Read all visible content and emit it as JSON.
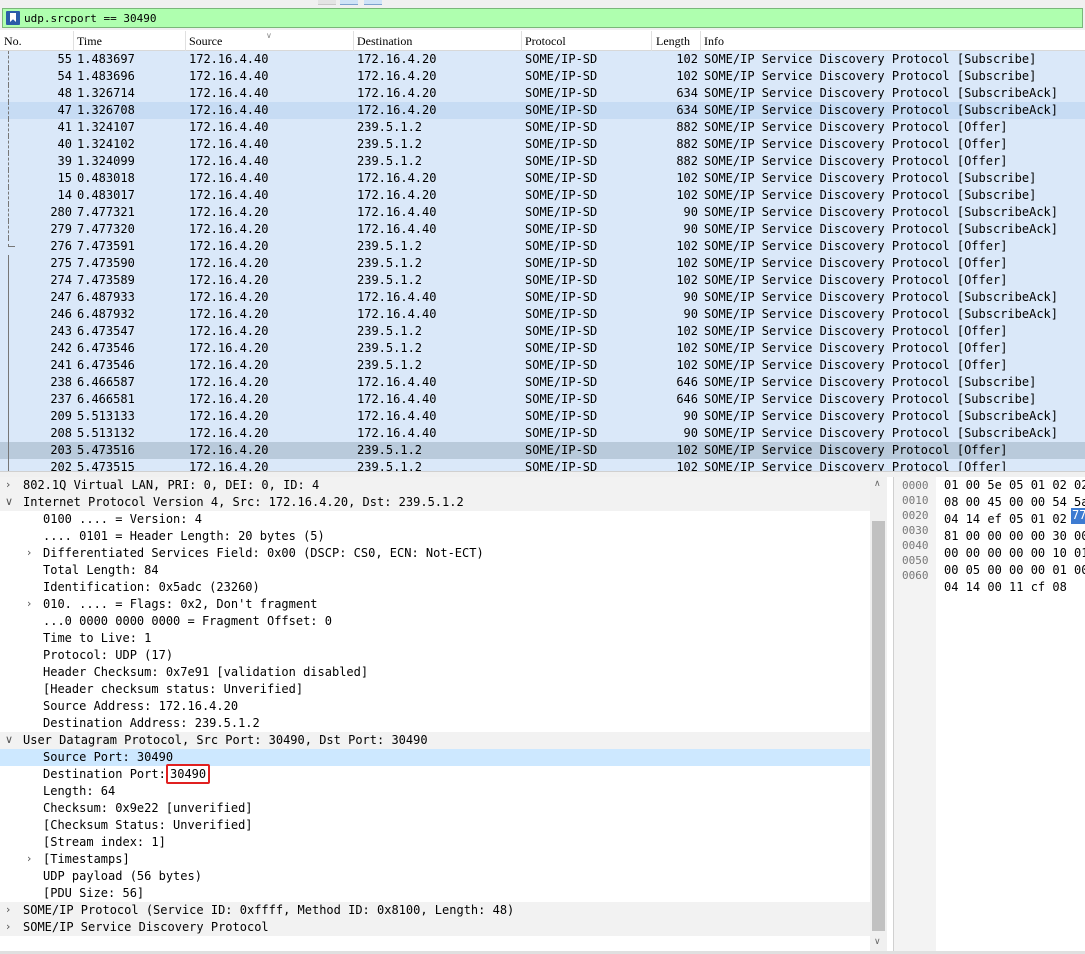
{
  "filter": {
    "expression": "udp.srcport == 30490"
  },
  "columns": [
    "No.",
    "Time",
    "Source",
    "Destination",
    "Protocol",
    "Length",
    "Info"
  ],
  "packets": [
    {
      "no": "55",
      "time": "1.483697",
      "src": "172.16.4.40",
      "dst": "172.16.4.20",
      "proto": "SOME/IP-SD",
      "len": "102",
      "info": "SOME/IP Service Discovery Protocol [Subscribe]"
    },
    {
      "no": "54",
      "time": "1.483696",
      "src": "172.16.4.40",
      "dst": "172.16.4.20",
      "proto": "SOME/IP-SD",
      "len": "102",
      "info": "SOME/IP Service Discovery Protocol [Subscribe]"
    },
    {
      "no": "48",
      "time": "1.326714",
      "src": "172.16.4.40",
      "dst": "172.16.4.20",
      "proto": "SOME/IP-SD",
      "len": "634",
      "info": "SOME/IP Service Discovery Protocol [SubscribeAck]"
    },
    {
      "no": "47",
      "time": "1.326708",
      "src": "172.16.4.40",
      "dst": "172.16.4.20",
      "proto": "SOME/IP-SD",
      "len": "634",
      "info": "SOME/IP Service Discovery Protocol [SubscribeAck]"
    },
    {
      "no": "41",
      "time": "1.324107",
      "src": "172.16.4.40",
      "dst": "239.5.1.2",
      "proto": "SOME/IP-SD",
      "len": "882",
      "info": "SOME/IP Service Discovery Protocol [Offer]"
    },
    {
      "no": "40",
      "time": "1.324102",
      "src": "172.16.4.40",
      "dst": "239.5.1.2",
      "proto": "SOME/IP-SD",
      "len": "882",
      "info": "SOME/IP Service Discovery Protocol [Offer]"
    },
    {
      "no": "39",
      "time": "1.324099",
      "src": "172.16.4.40",
      "dst": "239.5.1.2",
      "proto": "SOME/IP-SD",
      "len": "882",
      "info": "SOME/IP Service Discovery Protocol [Offer]"
    },
    {
      "no": "15",
      "time": "0.483018",
      "src": "172.16.4.40",
      "dst": "172.16.4.20",
      "proto": "SOME/IP-SD",
      "len": "102",
      "info": "SOME/IP Service Discovery Protocol [Subscribe]"
    },
    {
      "no": "14",
      "time": "0.483017",
      "src": "172.16.4.40",
      "dst": "172.16.4.20",
      "proto": "SOME/IP-SD",
      "len": "102",
      "info": "SOME/IP Service Discovery Protocol [Subscribe]"
    },
    {
      "no": "280",
      "time": "7.477321",
      "src": "172.16.4.20",
      "dst": "172.16.4.40",
      "proto": "SOME/IP-SD",
      "len": "90",
      "info": "SOME/IP Service Discovery Protocol [SubscribeAck]"
    },
    {
      "no": "279",
      "time": "7.477320",
      "src": "172.16.4.20",
      "dst": "172.16.4.40",
      "proto": "SOME/IP-SD",
      "len": "90",
      "info": "SOME/IP Service Discovery Protocol [SubscribeAck]"
    },
    {
      "no": "276",
      "time": "7.473591",
      "src": "172.16.4.20",
      "dst": "239.5.1.2",
      "proto": "SOME/IP-SD",
      "len": "102",
      "info": "SOME/IP Service Discovery Protocol [Offer]"
    },
    {
      "no": "275",
      "time": "7.473590",
      "src": "172.16.4.20",
      "dst": "239.5.1.2",
      "proto": "SOME/IP-SD",
      "len": "102",
      "info": "SOME/IP Service Discovery Protocol [Offer]"
    },
    {
      "no": "274",
      "time": "7.473589",
      "src": "172.16.4.20",
      "dst": "239.5.1.2",
      "proto": "SOME/IP-SD",
      "len": "102",
      "info": "SOME/IP Service Discovery Protocol [Offer]"
    },
    {
      "no": "247",
      "time": "6.487933",
      "src": "172.16.4.20",
      "dst": "172.16.4.40",
      "proto": "SOME/IP-SD",
      "len": "90",
      "info": "SOME/IP Service Discovery Protocol [SubscribeAck]"
    },
    {
      "no": "246",
      "time": "6.487932",
      "src": "172.16.4.20",
      "dst": "172.16.4.40",
      "proto": "SOME/IP-SD",
      "len": "90",
      "info": "SOME/IP Service Discovery Protocol [SubscribeAck]"
    },
    {
      "no": "243",
      "time": "6.473547",
      "src": "172.16.4.20",
      "dst": "239.5.1.2",
      "proto": "SOME/IP-SD",
      "len": "102",
      "info": "SOME/IP Service Discovery Protocol [Offer]"
    },
    {
      "no": "242",
      "time": "6.473546",
      "src": "172.16.4.20",
      "dst": "239.5.1.2",
      "proto": "SOME/IP-SD",
      "len": "102",
      "info": "SOME/IP Service Discovery Protocol [Offer]"
    },
    {
      "no": "241",
      "time": "6.473546",
      "src": "172.16.4.20",
      "dst": "239.5.1.2",
      "proto": "SOME/IP-SD",
      "len": "102",
      "info": "SOME/IP Service Discovery Protocol [Offer]"
    },
    {
      "no": "238",
      "time": "6.466587",
      "src": "172.16.4.20",
      "dst": "172.16.4.40",
      "proto": "SOME/IP-SD",
      "len": "646",
      "info": "SOME/IP Service Discovery Protocol [Subscribe]"
    },
    {
      "no": "237",
      "time": "6.466581",
      "src": "172.16.4.20",
      "dst": "172.16.4.40",
      "proto": "SOME/IP-SD",
      "len": "646",
      "info": "SOME/IP Service Discovery Protocol [Subscribe]"
    },
    {
      "no": "209",
      "time": "5.513133",
      "src": "172.16.4.20",
      "dst": "172.16.4.40",
      "proto": "SOME/IP-SD",
      "len": "90",
      "info": "SOME/IP Service Discovery Protocol [SubscribeAck]"
    },
    {
      "no": "208",
      "time": "5.513132",
      "src": "172.16.4.20",
      "dst": "172.16.4.40",
      "proto": "SOME/IP-SD",
      "len": "90",
      "info": "SOME/IP Service Discovery Protocol [SubscribeAck]"
    },
    {
      "no": "203",
      "time": "5.473516",
      "src": "172.16.4.20",
      "dst": "239.5.1.2",
      "proto": "SOME/IP-SD",
      "len": "102",
      "info": "SOME/IP Service Discovery Protocol [Offer]"
    },
    {
      "no": "202",
      "time": "5.473515",
      "src": "172.16.4.20",
      "dst": "239.5.1.2",
      "proto": "SOME/IP-SD",
      "len": "102",
      "info": "SOME/IP Service Discovery Protocol [Offer]"
    }
  ],
  "detail": {
    "vlan": "802.1Q Virtual LAN, PRI: 0, DEI: 0, ID: 4",
    "ipv4": "Internet Protocol Version 4, Src: 172.16.4.20, Dst: 239.5.1.2",
    "ip_fields": {
      "version": "0100 .... = Version: 4",
      "header_length": ".... 0101 = Header Length: 20 bytes (5)",
      "dsfield": "Differentiated Services Field: 0x00 (DSCP: CS0, ECN: Not-ECT)",
      "total_length": "Total Length: 84",
      "identification": "Identification: 0x5adc (23260)",
      "flags": "010. .... = Flags: 0x2, Don't fragment",
      "frag_offset": "...0 0000 0000 0000 = Fragment Offset: 0",
      "ttl": "Time to Live: 1",
      "protocol": "Protocol: UDP (17)",
      "checksum": "Header Checksum: 0x7e91 [validation disabled]",
      "checksum_status": "[Header checksum status: Unverified]",
      "src_addr": "Source Address: 172.16.4.20",
      "dst_addr": "Destination Address: 239.5.1.2"
    },
    "udp": "User Datagram Protocol, Src Port: 30490, Dst Port: 30490",
    "udp_fields": {
      "src_port": "Source Port: 30490",
      "dst_port_label": "Destination Port: ",
      "dst_port_value": "30490",
      "length": "Length: 64",
      "checksum": "Checksum: 0x9e22 [unverified]",
      "checksum_status": "[Checksum Status: Unverified]",
      "stream_index": "[Stream index: 1]",
      "timestamps": "[Timestamps]",
      "payload": "UDP payload (56 bytes)",
      "pdu_size": "[PDU Size: 56]"
    },
    "someip": "SOME/IP Protocol (Service ID: 0xffff, Method ID: 0x8100, Length: 48)",
    "someip_sd": "SOME/IP Service Discovery Protocol"
  },
  "hex": {
    "offsets": [
      "0000",
      "0010",
      "0020",
      "0030",
      "0040",
      "0050",
      "0060"
    ],
    "lines": [
      "01 00 5e 05 01 02 02",
      "08 00 45 00 00 54 5a",
      "04 14 ef 05 01 02",
      "81 00 00 00 00 30 00",
      "00 00 00 00 00 10 01",
      "00 05 00 00 00 01 00",
      "04 14 00 11 cf 08"
    ],
    "selected_byte": "77"
  },
  "colors": {
    "row_bg": "#dae8f9",
    "row_selected": "#b9cadb",
    "filter_bg": "#afffaf",
    "highlight_box": "#e02020"
  }
}
